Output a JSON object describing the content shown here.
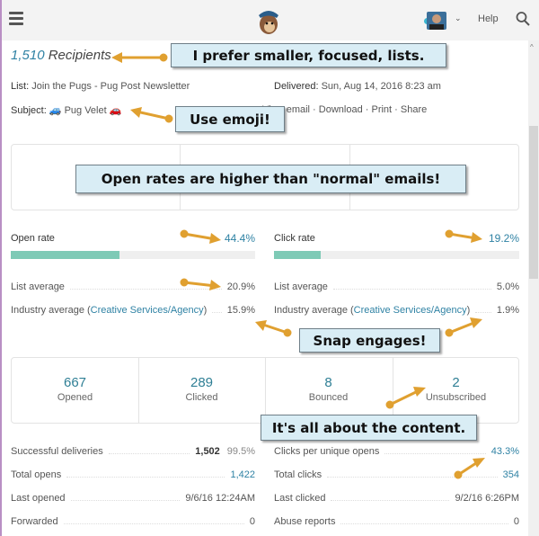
{
  "header": {
    "help_label": "Help",
    "icons": [
      "menu-icon",
      "mailchimp-logo",
      "avatar",
      "chevron-down-icon",
      "search-icon"
    ]
  },
  "summary": {
    "recipients_count": "1,510",
    "recipients_label": "Recipients",
    "list_label": "List:",
    "list_value": "Join the Pugs - Pug Post Newsletter",
    "delivered_label": "Delivered:",
    "delivered_value": "Sun, Aug 14, 2016 8:23 am",
    "subject_label": "Subject:",
    "subject_value": "🚙 Pug Velet 🚗",
    "links": [
      "View email",
      "Download",
      "Print",
      "Share"
    ]
  },
  "rates": {
    "open": {
      "label": "Open rate",
      "value": "44.4%",
      "percent": 44.4,
      "list_avg_label": "List average",
      "list_avg": "20.9%",
      "industry_label": "Industry average (",
      "industry_link": "Creative Services/Agency",
      "industry_close": ")",
      "industry_avg": "15.9%"
    },
    "click": {
      "label": "Click rate",
      "value": "19.2%",
      "percent": 19.2,
      "list_avg_label": "List average",
      "list_avg": "5.0%",
      "industry_label": "Industry average (",
      "industry_link": "Creative Services/Agency",
      "industry_close": ")",
      "industry_avg": "1.9%"
    }
  },
  "stats": [
    {
      "n": "667",
      "l": "Opened"
    },
    {
      "n": "289",
      "l": "Clicked"
    },
    {
      "n": "8",
      "l": "Bounced"
    },
    {
      "n": "2",
      "l": "Unsubscribed"
    }
  ],
  "details_left": [
    {
      "label": "Successful deliveries",
      "value": "1,502",
      "extra": "99.5%"
    },
    {
      "label": "Total opens",
      "value": "1,422"
    },
    {
      "label": "Last opened",
      "value": "9/6/16 12:24AM"
    },
    {
      "label": "Forwarded",
      "value": "0"
    }
  ],
  "details_right": [
    {
      "label": "Clicks per unique opens",
      "value": "43.3%"
    },
    {
      "label": "Total clicks",
      "value": "354"
    },
    {
      "label": "Last clicked",
      "value": "9/2/16 6:26PM"
    },
    {
      "label": "Abuse reports",
      "value": "0"
    }
  ],
  "callouts": [
    "I prefer smaller, focused, lists.",
    "Use emoji!",
    "Open rates are higher than \"normal\" emails!",
    "Snap engages!",
    "It's all about the content."
  ],
  "colors": {
    "accent": "#2f82a4",
    "bar": "#7ecab6",
    "callout_bg": "#d9edf5",
    "arrow": "#e0a030"
  }
}
